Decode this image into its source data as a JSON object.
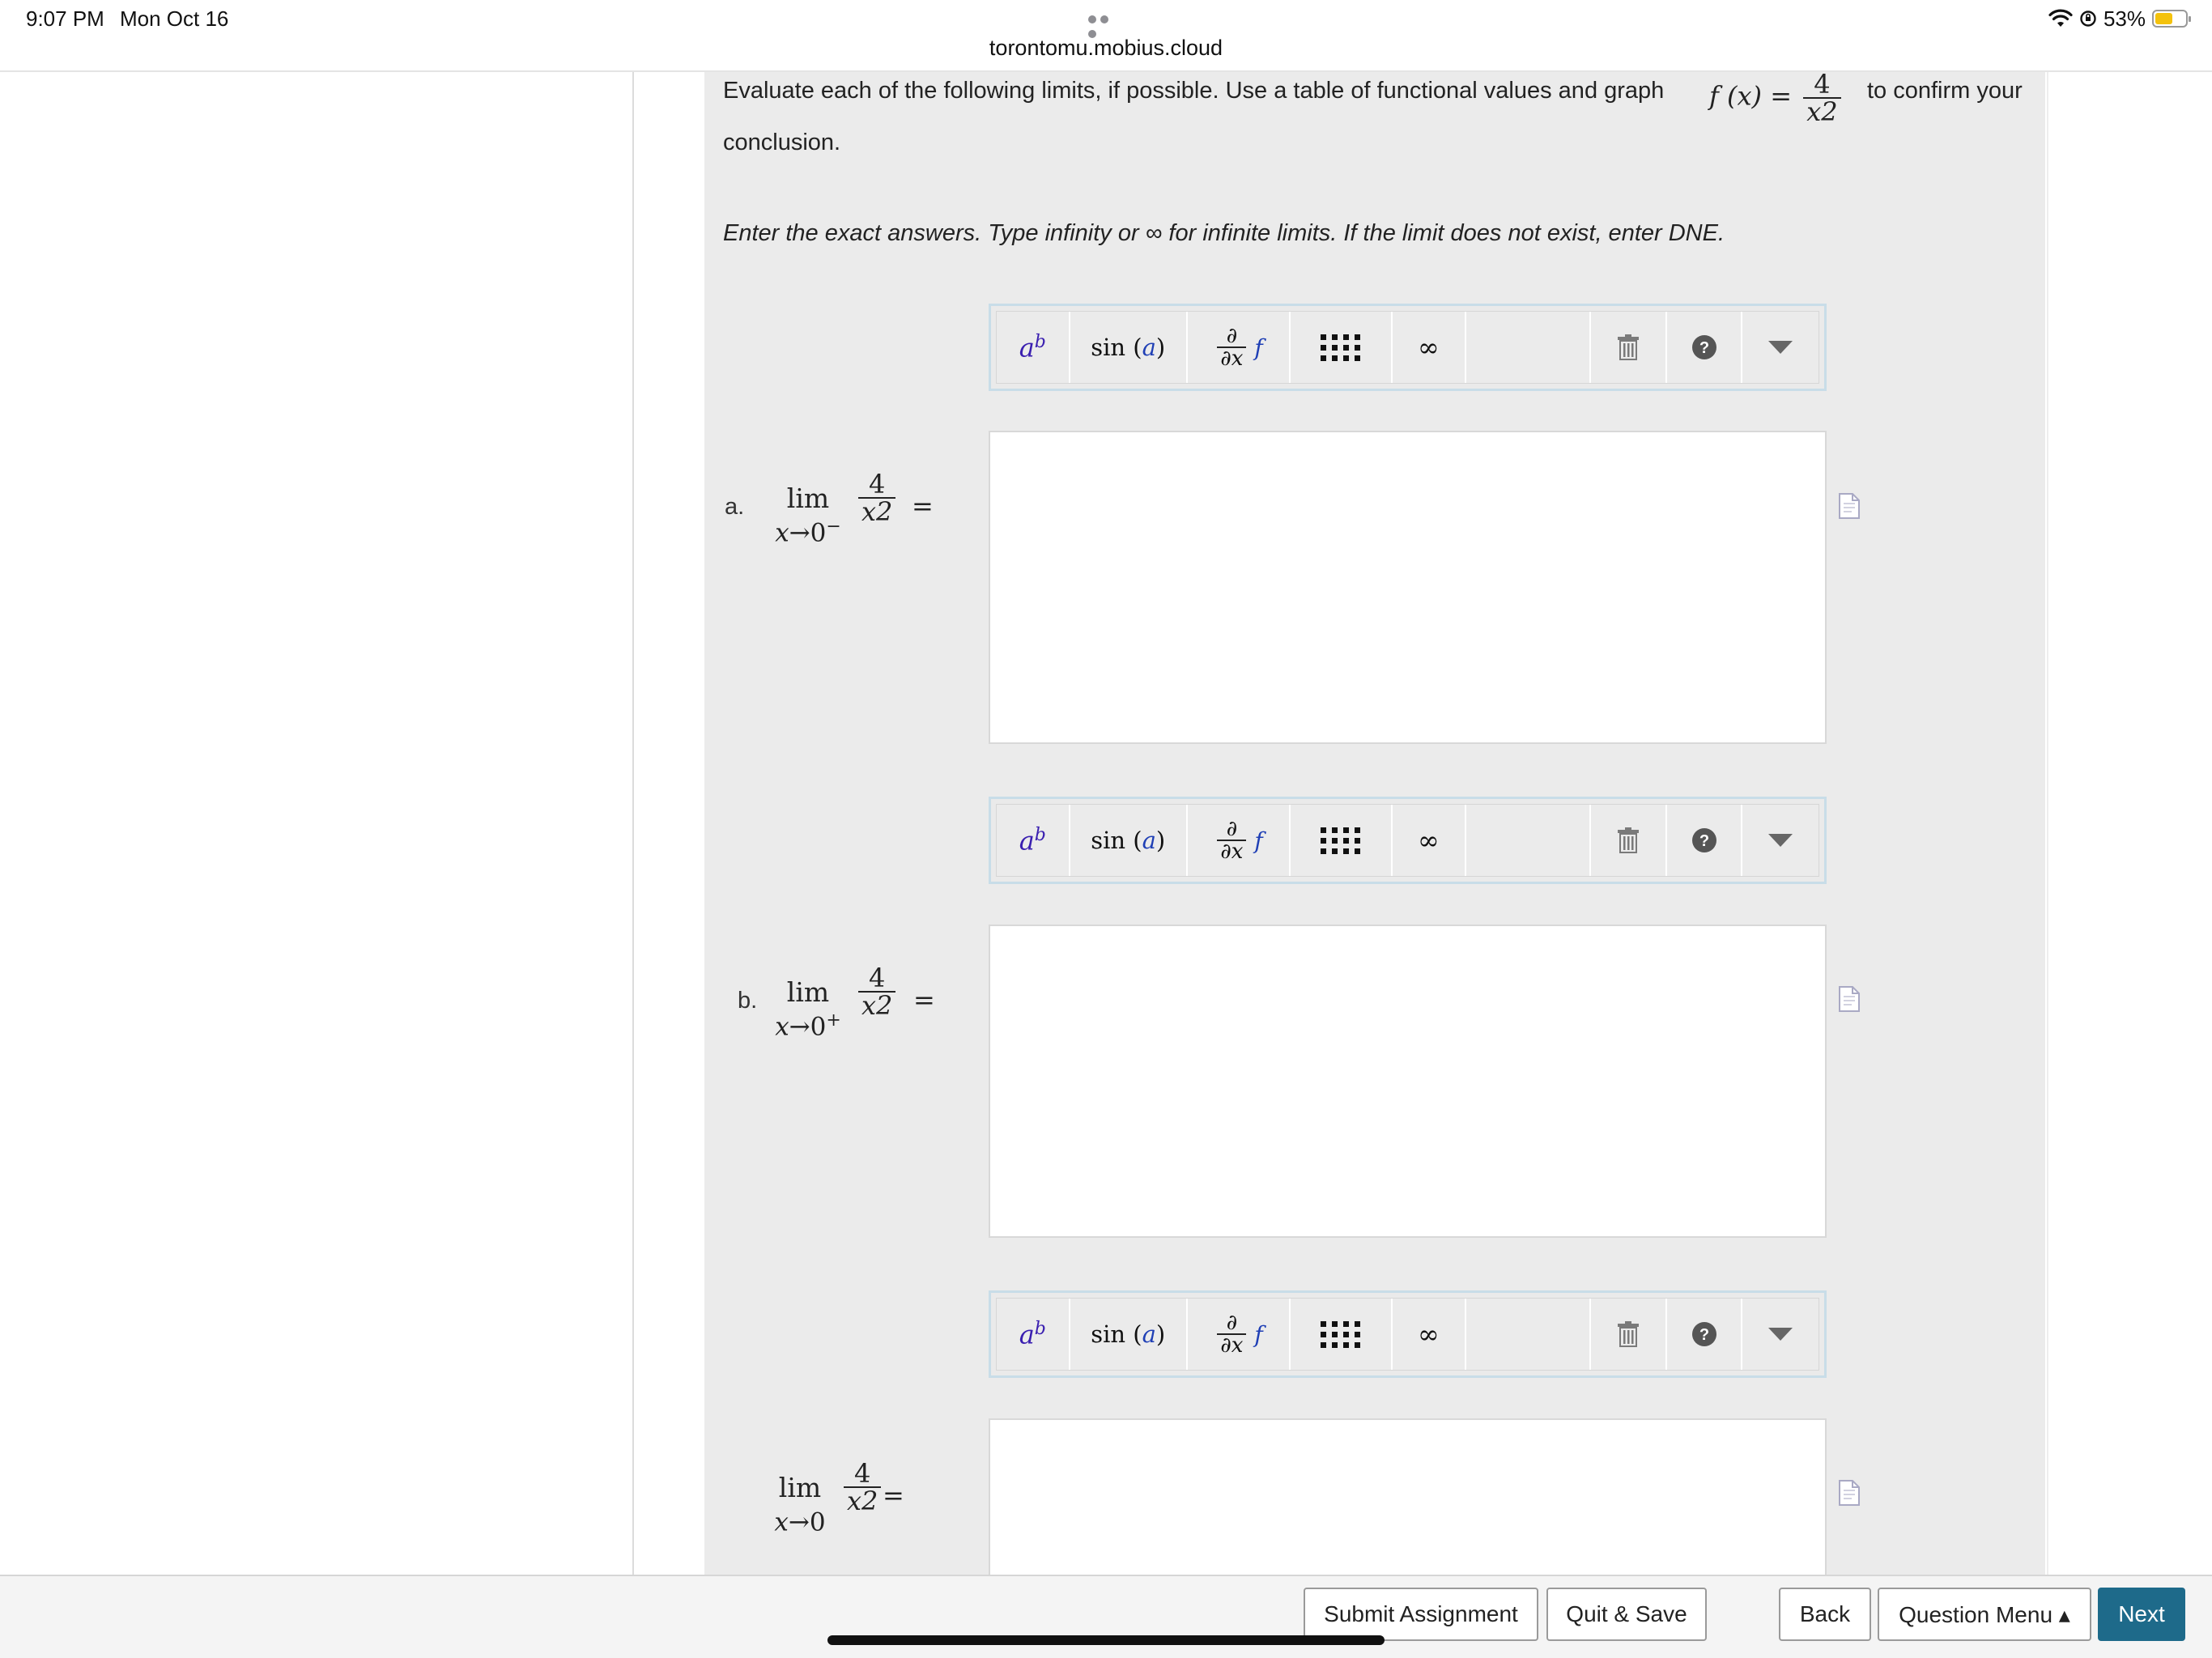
{
  "status_bar": {
    "time": "9:07 PM",
    "date": "Mon Oct 16",
    "url": "torontomu.mobius.cloud",
    "battery": "53%",
    "battery_level": 0.53
  },
  "question": {
    "prompt_start": "Evaluate each of the following limits, if possible. Use a table of functional values and graph",
    "function_lhs": "f (x) =",
    "function_numerator": "4",
    "function_denominator": "x2",
    "prompt_end": "to confirm your",
    "prompt_wrap": "conclusion.",
    "instructions": "Enter the exact answers. Type infinity or ∞ for infinite limits. If the limit does not exist, enter DNE."
  },
  "toolbar": {
    "power_base": "a",
    "power_exp": "b",
    "sin_label": "sin",
    "sin_arg": "a",
    "deriv_num": "∂",
    "deriv_den": "∂x",
    "deriv_f": "f",
    "infinity": "∞"
  },
  "parts": [
    {
      "label": "a.",
      "lim": "lim",
      "var": "x",
      "arrow": "→0",
      "side": "−",
      "numerator": "4",
      "denominator": "x2",
      "equals": "=",
      "answer": ""
    },
    {
      "label": "b.",
      "lim": "lim",
      "var": "x",
      "arrow": "→0",
      "side": "+",
      "numerator": "4",
      "denominator": "x2",
      "equals": "=",
      "answer": ""
    },
    {
      "label": "",
      "lim": "lim",
      "var": "x",
      "arrow": "→0",
      "side": "",
      "numerator": "4",
      "denominator": "x2",
      "equals": "=",
      "answer": ""
    }
  ],
  "footer": {
    "submit": "Submit Assignment",
    "quit": "Quit & Save",
    "back": "Back",
    "menu": "Question Menu ▴",
    "next": "Next"
  },
  "colors": {
    "primary_button": "#1e6a8a",
    "panel_bg": "#ebebeb",
    "battery_fill": "#f4c20d",
    "math_blue": "#1f3fb5"
  }
}
